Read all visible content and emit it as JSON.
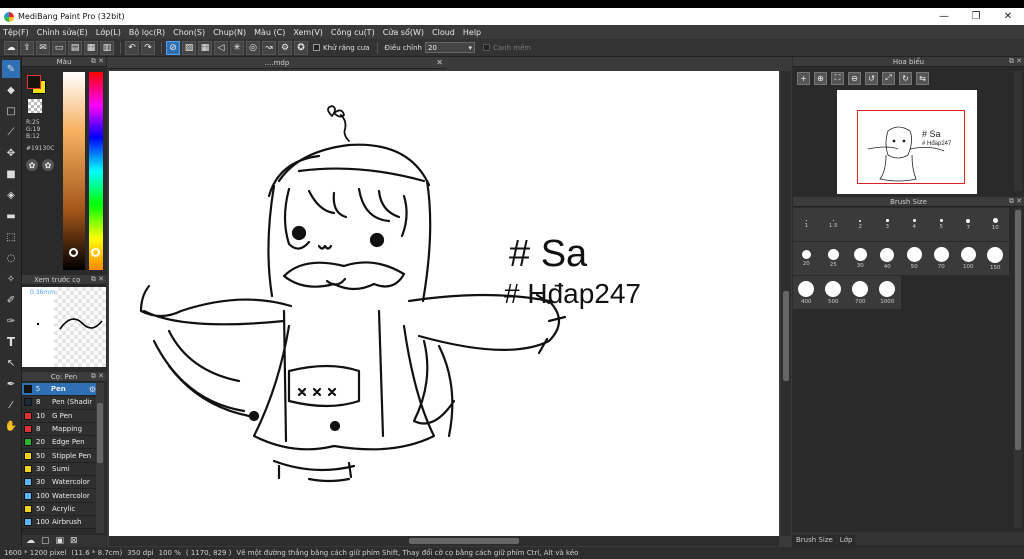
{
  "window": {
    "title": "MediBang Paint Pro (32bit)",
    "minimize": "—",
    "maximize": "❐",
    "close": "✕"
  },
  "menu": [
    "Tệp(F)",
    "Chỉnh sửa(E)",
    "Lớp(L)",
    "Bộ lọc(R)",
    "Chon(S)",
    "Chup(N)",
    "Màu (C)",
    "Xem(V)",
    "Công cu(T)",
    "Cửa sổ(W)",
    "Cloud",
    "Help"
  ],
  "toolbar": {
    "antialias_label": "Khử răng cưa",
    "adjust_label": "Điều chỉnh",
    "adjust_value": "20",
    "snap_label": "Canh mềm"
  },
  "color_panel": {
    "title": "Màu",
    "r": "R:25",
    "g": "G:19",
    "b": "B:12",
    "hex": "#19130C",
    "fg_color": "#19130c",
    "bg_color": "#f5e10e"
  },
  "preview_panel": {
    "title": "Xem trước cọ",
    "size": "0.36mm"
  },
  "brush_panel": {
    "title": "Cọ: Pen",
    "brushes": [
      {
        "size": "5",
        "name": "Pen",
        "color": "#19130c"
      },
      {
        "size": "8",
        "name": "Pen (Shading)",
        "color": "#1a2a3a"
      },
      {
        "size": "10",
        "name": "G Pen",
        "color": "#e03030"
      },
      {
        "size": "8",
        "name": "Mapping",
        "color": "#e03030"
      },
      {
        "size": "20",
        "name": "Edge Pen",
        "color": "#30b030"
      },
      {
        "size": "50",
        "name": "Stipple Pen",
        "color": "#f2d21a"
      },
      {
        "size": "30",
        "name": "Sumi",
        "color": "#f2d21a"
      },
      {
        "size": "30",
        "name": "Watercolor",
        "color": "#5ab4f0"
      },
      {
        "size": "100",
        "name": "Watercolor",
        "color": "#5ab4f0"
      },
      {
        "size": "50",
        "name": "Acrylic",
        "color": "#f2d21a"
      },
      {
        "size": "100",
        "name": "Airbrush",
        "color": "#5ab4f0"
      }
    ]
  },
  "canvas": {
    "tab_title": "....mdp",
    "text_line1": "# Sa",
    "text_line2": "# Hđap247"
  },
  "navigator": {
    "title": "Hoa biểu"
  },
  "brush_size_panel": {
    "title": "Brush Size",
    "sizes": [
      "1",
      "1.5",
      "2",
      "3",
      "4",
      "5",
      "7",
      "10",
      "20",
      "25",
      "30",
      "40",
      "50",
      "70",
      "100",
      "150",
      "400",
      "500",
      "700",
      "1000"
    ]
  },
  "right_tabs": [
    "Brush Size",
    "Lớp"
  ],
  "status": {
    "dimensions": "1600 * 1200 pixel",
    "physical": "(11.6 * 8.7cm)",
    "dpi": "350 dpi",
    "zoom": "100 %",
    "cursor": "( 1170, 829 )",
    "hint": "Vẽ một đường thẳng bằng cách giữ phím Shift, Thay đổi cỡ cọ bằng cách giữ phím Ctrl, Alt và kéo"
  }
}
